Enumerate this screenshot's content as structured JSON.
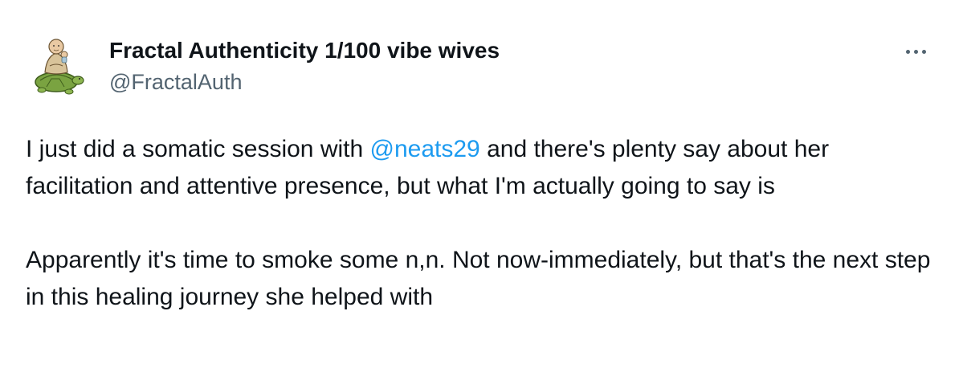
{
  "author": {
    "display_name": "Fractal Authenticity 1/100 vibe wives",
    "handle": "@FractalAuth",
    "avatar_icon": "monk-on-turtle-avatar-icon"
  },
  "menu": {
    "icon": "more-horizontal-icon"
  },
  "tweet": {
    "line1_before": "I just did a somatic session with ",
    "mention": "@neats29",
    "line1_after": " and there's plenty say about her facilitation and attentive presence, but what I'm actually going to say is",
    "paragraph2": "Apparently it's time to smoke some n,n. Not now-immediately, but that's the next step in this healing journey she helped with"
  },
  "colors": {
    "text": "#0f1419",
    "secondary": "#536471",
    "link": "#1d9bf0"
  }
}
